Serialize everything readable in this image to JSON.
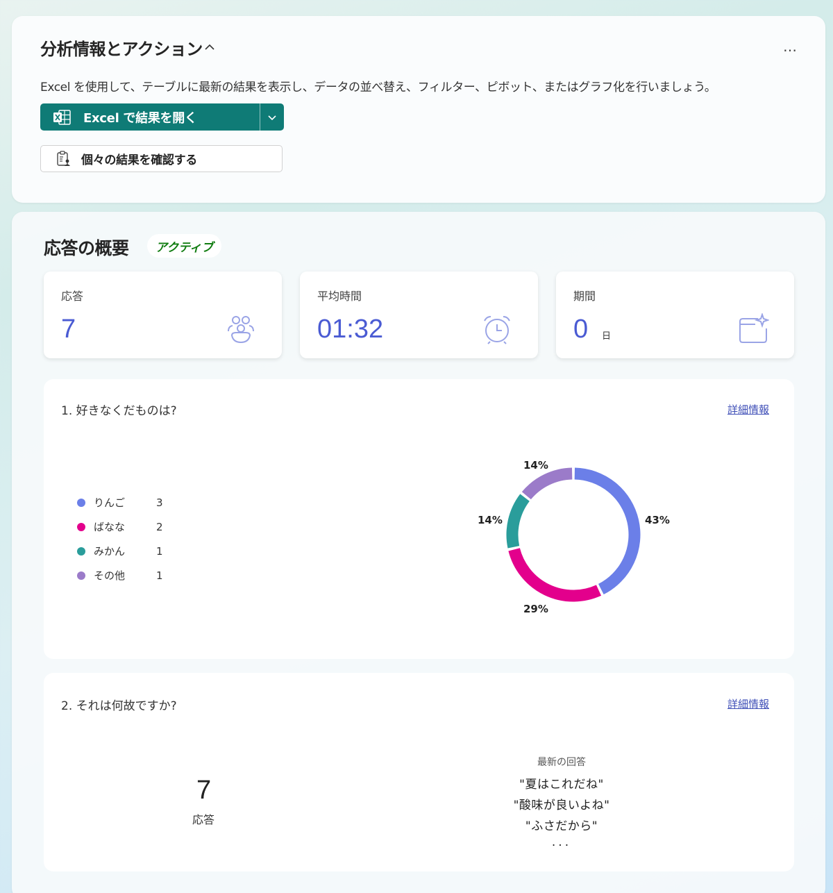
{
  "analysis": {
    "title": "分析情報とアクション",
    "more_icon": "…",
    "description": "Excel を使用して、テーブルに最新の結果を表示し、データの並べ替え、フィルター、ピボット、またはグラフ化を行いましょう。",
    "open_excel_label": "Excel で結果を開く",
    "review_label": "個々の結果を確認する"
  },
  "summary": {
    "title": "応答の概要",
    "status": "アクティブ",
    "stats": [
      {
        "label": "応答",
        "value": "7",
        "unit": "",
        "icon": "people-icon"
      },
      {
        "label": "平均時間",
        "value": "01:32",
        "unit": "",
        "icon": "alarm-clock-icon"
      },
      {
        "label": "期間",
        "value": "0",
        "unit": "日",
        "icon": "calendar-sparkle-icon"
      }
    ]
  },
  "q1": {
    "title": "1. 好きなくだものは?",
    "more_link": "詳細情報",
    "legend": [
      {
        "name": "りんご",
        "count": "3",
        "color": "#6b7fe8"
      },
      {
        "name": "ばなな",
        "count": "2",
        "color": "#e3008c"
      },
      {
        "name": "みかん",
        "count": "1",
        "color": "#2a9d9b"
      },
      {
        "name": "その他",
        "count": "1",
        "color": "#9b7bc9"
      }
    ],
    "percent_labels": [
      "43%",
      "29%",
      "14%",
      "14%"
    ]
  },
  "q2": {
    "title": "2. それは何故ですか?",
    "more_link": "詳細情報",
    "count": "7",
    "count_label": "応答",
    "recent_header": "最新の回答",
    "recent": [
      "\"夏はこれだね\"",
      "\"酸味が良いよね\"",
      "\"ふさだから\""
    ],
    "ellipsis": "..."
  },
  "chart_data": {
    "type": "pie",
    "title": "1. 好きなくだものは?",
    "categories": [
      "りんご",
      "ばなな",
      "みかん",
      "その他"
    ],
    "values": [
      3,
      2,
      1,
      1
    ],
    "percent_labels": [
      "43%",
      "29%",
      "14%",
      "14%"
    ],
    "colors": [
      "#6b7fe8",
      "#e3008c",
      "#2a9d9b",
      "#9b7bc9"
    ],
    "donut": true,
    "legend_position": "left"
  }
}
